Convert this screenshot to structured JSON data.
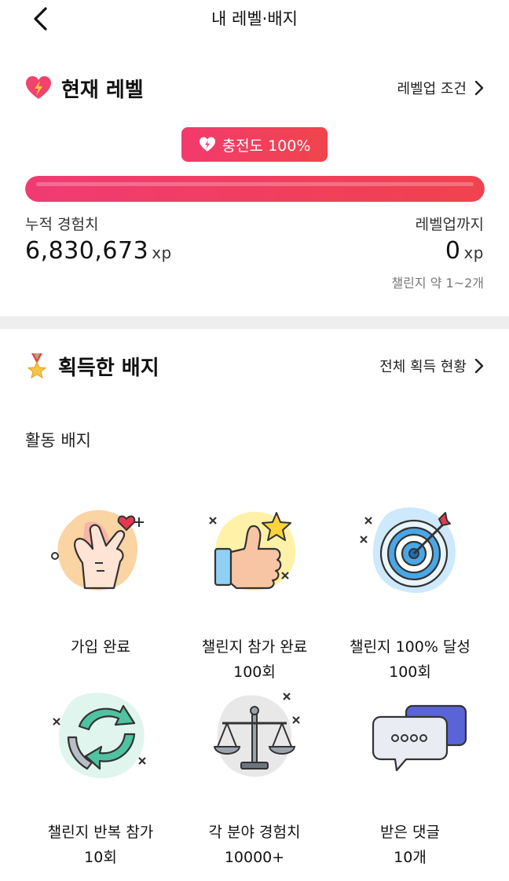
{
  "header": {
    "title": "내 레벨·배지",
    "back_icon": "chevron-left-icon"
  },
  "level": {
    "title": "현재 레벨",
    "icon": "heart-bolt-icon",
    "link_label": "레벨업 조건",
    "charge_label": "충전도 100%",
    "charge_percent": 100,
    "accent_color": "#f23a6e",
    "accumulated_label": "누적 경험치",
    "accumulated_value": "6,830,673",
    "accumulated_unit": "xp",
    "remaining_label": "레벨업까지",
    "remaining_value": "0",
    "remaining_unit": "xp",
    "remaining_note": "챌린지 약 1~2개"
  },
  "badges": {
    "title": "획득한 배지",
    "icon": "medal-icon",
    "link_label": "전체 획득 현황",
    "subheading": "활동 배지",
    "items": [
      {
        "icon": "finger-heart-icon",
        "name": "가입 완료",
        "count": ""
      },
      {
        "icon": "thumbs-up-star-icon",
        "name": "챌린지 참가 완료",
        "count": "100회"
      },
      {
        "icon": "target-arrow-icon",
        "name": "챌린지 100% 달성",
        "count": "100회"
      },
      {
        "icon": "repeat-arrows-icon",
        "name": "챌린지 반복 참가",
        "count": "10회"
      },
      {
        "icon": "balance-scale-icon",
        "name": "각 분야 경험치",
        "count": "10000+"
      },
      {
        "icon": "chat-bubbles-icon",
        "name": "받은 댓글",
        "count": "10개"
      }
    ]
  }
}
